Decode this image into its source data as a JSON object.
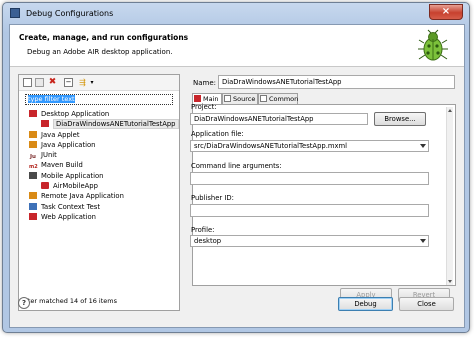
{
  "window": {
    "title": "Debug Configurations",
    "close_glyph": "×"
  },
  "header": {
    "title": "Create, manage, and run configurations",
    "subtitle": "Debug an Adobe AIR desktop application."
  },
  "left": {
    "filter_text": "type filter text",
    "tree": [
      {
        "label": "Desktop Application",
        "icon": "adobe-icon",
        "level": 1
      },
      {
        "label": "DiaDraWindowsANETutorialTestApp",
        "icon": "adobe-icon",
        "level": 2,
        "selected": true
      },
      {
        "label": "Java Applet",
        "icon": "java-icon",
        "level": 1
      },
      {
        "label": "Java Application",
        "icon": "java-icon",
        "level": 1
      },
      {
        "label": "JUnit",
        "icon": "junit-icon",
        "level": 1
      },
      {
        "label": "Maven Build",
        "icon": "m2-icon",
        "level": 1
      },
      {
        "label": "Mobile Application",
        "icon": "mobile-icon",
        "level": 1
      },
      {
        "label": "AirMobileApp",
        "icon": "air-icon",
        "level": 2
      },
      {
        "label": "Remote Java Application",
        "icon": "java-icon",
        "level": 1
      },
      {
        "label": "Task Context Test",
        "icon": "task-icon",
        "level": 1
      },
      {
        "label": "Web Application",
        "icon": "adobe-icon",
        "level": 1
      }
    ],
    "status": "Filter matched 14 of 16 items"
  },
  "right": {
    "name_label": "Name:",
    "name_value": "DiaDraWindowsANETutorialTestApp",
    "tabs": [
      {
        "label": "Main"
      },
      {
        "label": "Source"
      },
      {
        "label": "Common"
      }
    ],
    "project_label": "Project:",
    "project_value": "DiaDraWindowsANETutorialTestApp",
    "browse_label": "Browse...",
    "app_file_label": "Application file:",
    "app_file_value": "src/DiaDraWindowsANETutorialTestApp.mxml",
    "cmd_label": "Command line arguments:",
    "cmd_value": "",
    "publisher_label": "Publisher ID:",
    "publisher_value": "",
    "profile_label": "Profile:",
    "profile_value": "desktop",
    "apply_label": "Apply",
    "revert_label": "Revert"
  },
  "footer": {
    "help_glyph": "?",
    "debug_label": "Debug",
    "close_label": "Close"
  }
}
